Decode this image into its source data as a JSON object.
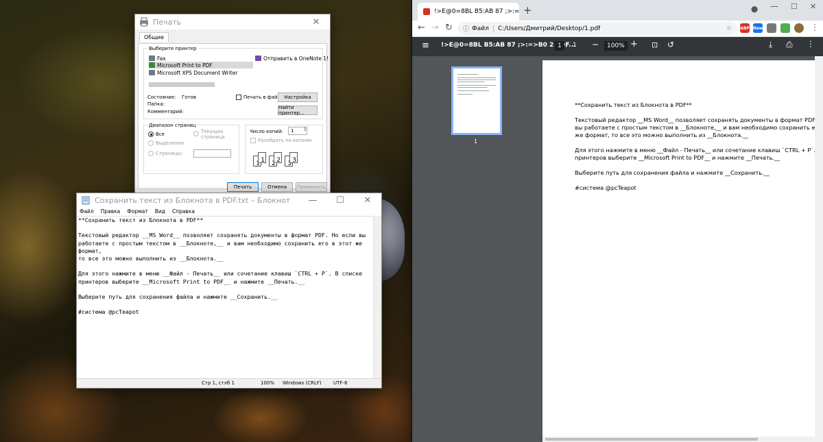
{
  "print_dialog": {
    "title": "Печать",
    "tab": "Общие",
    "select_printer_label": "Выберите принтер",
    "printers": [
      "Fax",
      "Microsoft Print to PDF",
      "Microsoft XPS Document Writer",
      "Отправить в OneNote 1!"
    ],
    "selected_printer": "Microsoft Print to PDF",
    "status_label": "Состояние:",
    "status_value": "Готов",
    "folder_label": "Папка:",
    "comment_label": "Комментарий:",
    "print_to_file": "Печать в файл",
    "settings_button": "Настройка",
    "find_printer_button": "Найти принтер...",
    "range_title": "Диапазон страниц",
    "range_all": "Все",
    "range_selection": "Выделение",
    "range_current": "Текущая страница",
    "range_pages": "Страницы:",
    "copies_label": "Число копий:",
    "copies_value": "1",
    "collate": "Разобрать по копиям",
    "copy_icons": [
      "1",
      "1",
      "2",
      "2",
      "3",
      "3"
    ],
    "print_button": "Печать",
    "cancel_button": "Отмена",
    "apply_button": "Применить"
  },
  "notepad": {
    "title": "Сохранить текст из Блокнота в PDF.txt – Блокнот",
    "menu": [
      "Файл",
      "Правка",
      "Формат",
      "Вид",
      "Справка"
    ],
    "text": "**Сохранить текст из Блокнота в PDF**\n\nТекстовый редактор __MS Word__ позволяет сохранять документы в формат PDF. Но если вы\nработаете с простым текстом в __Блокноте,__ и вам необходимо сохранить его в этот же формат,\nто все это можно выполнить из __Блокнота.__\n\nДля этого нажмите в меню __Файл - Печать__ или сочетание клавиш `CTRL + P`. В списке\nпринтеров выберите __Microsoft Print to PDF__ и нажмите __Печать.__\n\nВыберите путь для сохранения файла и нажмите __Сохранить.__\n\n#система @pcTeapot",
    "status": {
      "position": "Стр 1, стлб 1",
      "zoom": "100%",
      "line_endings": "Windows (CRLF)",
      "encoding": "UTF-8"
    }
  },
  "chrome": {
    "tab_title": "!>E@0=8BL B5:AB 87 ;>:=>B0 2",
    "address_label": "Файл",
    "address_url": "C:/Users/Дмитрий/Desktop/1.pdf",
    "extensions": [
      "ABP",
      "New"
    ],
    "pdf_title": "!>E@0=8BL B5:AB 87 ;>:=>B0 2 PDF...",
    "page_current": "1",
    "page_sep": "/",
    "page_total": "1",
    "zoom": "100%",
    "thumb_number": "1",
    "pdf_text": "**Сохранить текст из Блокнота в PDF**\n\nТекстовый редактор __MS Word__ позволяет сохранять документы в формат PDF. Но если\nвы работаете с простым текстом в __Блокноте,__ и вам необходимо сохранить его в этот\nже формат, то все это можно выполнить из __Блокнота.__\n\nДля этого нажмите в меню __Файл - Печать__ или сочетание клавиш `CTRL + P`. В списке\nпринтеров выберите __Microsoft Print to PDF__ и нажмите __Печать.__\n\nВыберите путь для сохранения файла и нажмите __Сохранить.__\n\n#система @pcTeapot"
  }
}
